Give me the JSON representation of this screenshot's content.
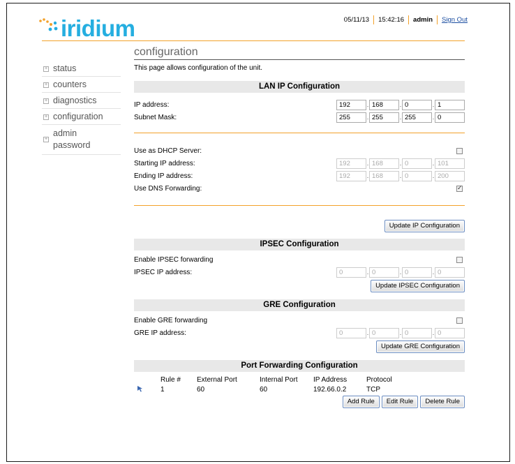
{
  "header": {
    "brand": "iridium",
    "date": "05/11/13",
    "time": "15:42:16",
    "user": "admin",
    "signout": "Sign Out"
  },
  "sidebar": {
    "items": [
      {
        "label": "status"
      },
      {
        "label": "counters"
      },
      {
        "label": "diagnostics"
      },
      {
        "label": "configuration"
      },
      {
        "label": "admin password"
      }
    ]
  },
  "page": {
    "title": "configuration",
    "intro": "This page allows configuration of the unit."
  },
  "lan": {
    "title": "LAN IP Configuration",
    "ip_label": "IP address:",
    "ip": [
      "192",
      "168",
      "0",
      "1"
    ],
    "mask_label": "Subnet Mask:",
    "mask": [
      "255",
      "255",
      "255",
      "0"
    ],
    "dhcp_label": "Use as DHCP Server:",
    "dhcp_checked": false,
    "start_label": "Starting IP address:",
    "start": [
      "192",
      "168",
      "0",
      "101"
    ],
    "end_label": "Ending IP address:",
    "end": [
      "192",
      "168",
      "0",
      "200"
    ],
    "dns_label": "Use DNS Forwarding:",
    "dns_checked": true,
    "update_button": "Update IP Configuration"
  },
  "ipsec": {
    "title": "IPSEC Configuration",
    "enable_label": "Enable IPSEC forwarding",
    "enable_checked": false,
    "ip_label": "IPSEC IP address:",
    "ip": [
      "0",
      "0",
      "0",
      "0"
    ],
    "update_button": "Update IPSEC Configuration"
  },
  "gre": {
    "title": "GRE Configuration",
    "enable_label": "Enable GRE forwarding",
    "enable_checked": false,
    "ip_label": "GRE IP address:",
    "ip": [
      "0",
      "0",
      "0",
      "0"
    ],
    "update_button": "Update GRE Configuration"
  },
  "port_forwarding": {
    "title": "Port Forwarding Configuration",
    "columns": [
      "Rule #",
      "External Port",
      "Internal Port",
      "IP Address",
      "Protocol"
    ],
    "rows": [
      {
        "rule": "1",
        "external": "60",
        "internal": "60",
        "ip": "192.66.0.2",
        "protocol": "TCP"
      }
    ],
    "add_button": "Add Rule",
    "edit_button": "Edit Rule",
    "delete_button": "Delete Rule"
  },
  "colors": {
    "brand": "#25aee0",
    "accent": "#f3a12a",
    "link": "#1a4da0",
    "section_bg": "#e8e8e8"
  }
}
